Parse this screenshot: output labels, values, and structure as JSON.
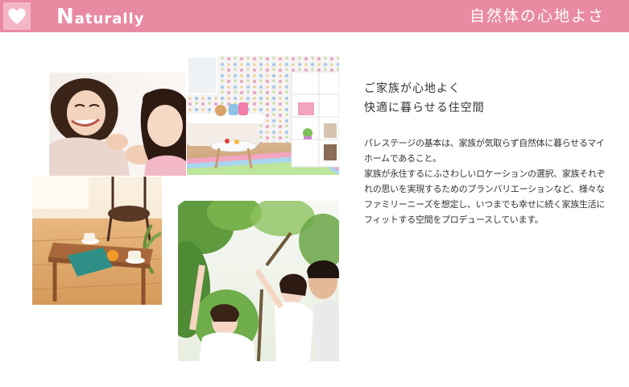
{
  "header": {
    "logo_initial": "N",
    "logo_rest": "aturally",
    "tagline": "自然体の心地よさ",
    "icon": "heart-icon",
    "colors": {
      "bar": "#e98aa3",
      "icon_box": "#f4b6c6"
    }
  },
  "photos": [
    {
      "subject": "mother-and-daughter-photo"
    },
    {
      "subject": "polka-dot-childrens-room-photo"
    },
    {
      "subject": "wooden-table-by-window-photo"
    },
    {
      "subject": "family-under-tree-photo"
    }
  ],
  "main": {
    "heading_lines": [
      "ご家族が心地よく",
      "快適に暮らせる住空間"
    ],
    "paragraphs": [
      "パレステージの基本は、家族が気取らず自然体に暮らせるマイホームであること。",
      "家族が永住するにふさわしいロケーションの選択、家族それぞれの思いを実現するためのプランバリエーションなど、様々なファミリーニーズを想定し、いつまでも幸せに続く家族生活にフィットする空間をプロデュースしています。"
    ]
  }
}
